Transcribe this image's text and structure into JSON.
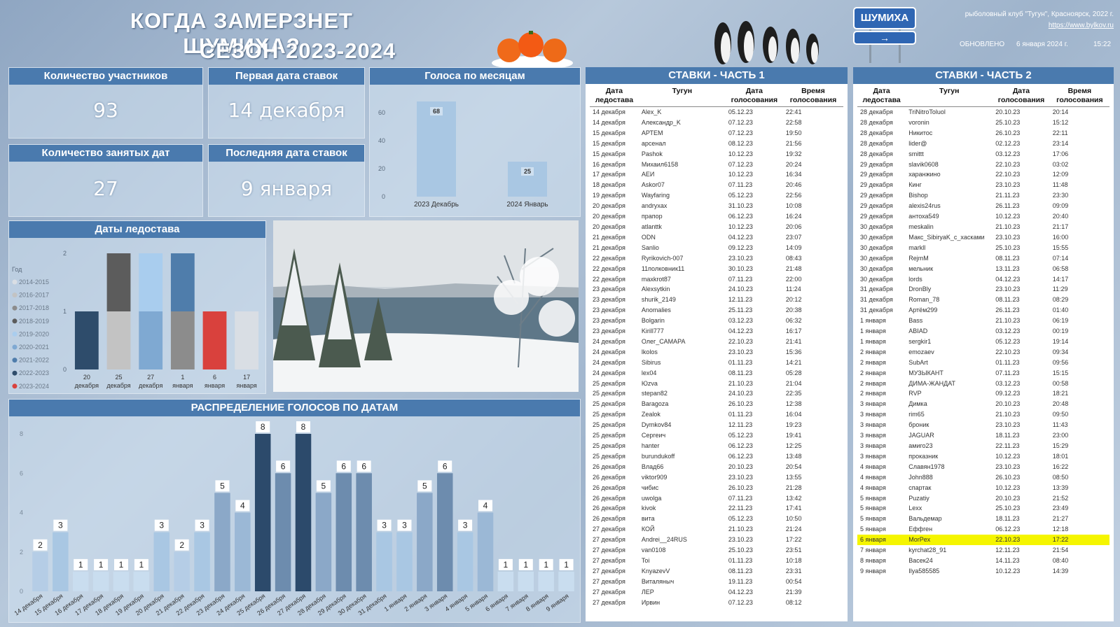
{
  "header": {
    "title_line1": "КОГДА ЗАМЕРЗНЕТ ШУМИХА?",
    "title_line2": "СЕЗОН 2023-2024",
    "sign_label": "ШУМИХА",
    "club": "рыболовный клуб \"Тугун\", Красноярск, 2022 г.",
    "link": "https://www.bylkov.ru",
    "updated_label": "ОБНОВЛЕНО",
    "updated_date": "6 января 2024 г.",
    "updated_time": "15:22"
  },
  "kpis": {
    "participants_label": "Количество участников",
    "participants_value": "93",
    "first_date_label": "Первая дата ставок",
    "first_date_value": "14 декабря",
    "dates_taken_label": "Количество занятых дат",
    "dates_taken_value": "27",
    "last_date_label": "Последняя дата ставок",
    "last_date_value": "9 января"
  },
  "colors": {
    "header_bg": "#4a7aae",
    "bar_light": "#a9c7e3",
    "bar_dark": "#2c4a6b",
    "highlight": "#f5f500",
    "red": "#d9413d"
  },
  "chart_data": [
    {
      "type": "bar",
      "title": "Голоса по месяцам",
      "categories": [
        "2023 Декабрь",
        "2024 Январь"
      ],
      "values": [
        68,
        25
      ],
      "ylim": [
        0,
        70
      ],
      "yticks": [
        0,
        20,
        40,
        60
      ],
      "color": "#a9c7e3"
    },
    {
      "type": "bar",
      "title": "Даты ледостава",
      "legend_title": "Год",
      "legend": [
        {
          "name": "2014-2015",
          "color": "#d9dee4"
        },
        {
          "name": "2016-2017",
          "color": "#c3c3c3"
        },
        {
          "name": "2017-2018",
          "color": "#8c8c8c"
        },
        {
          "name": "2018-2019",
          "color": "#5c5c5c"
        },
        {
          "name": "2019-2020",
          "color": "#a9cdee"
        },
        {
          "name": "2020-2021",
          "color": "#7fa9d2"
        },
        {
          "name": "2021-2022",
          "color": "#4f7dab"
        },
        {
          "name": "2022-2023",
          "color": "#2e4c6b"
        },
        {
          "name": "2023-2024",
          "color": "#d9413d"
        }
      ],
      "categories": [
        "20 декабря",
        "25 декабря",
        "27 декабря",
        "1 января",
        "6 января",
        "17 января"
      ],
      "stacks": [
        [
          {
            "series": "2022-2023",
            "value": 1
          }
        ],
        [
          {
            "series": "2016-2017",
            "value": 1
          },
          {
            "series": "2018-2019",
            "value": 1
          }
        ],
        [
          {
            "series": "2020-2021",
            "value": 1
          },
          {
            "series": "2019-2020",
            "value": 1
          }
        ],
        [
          {
            "series": "2017-2018",
            "value": 1
          },
          {
            "series": "2021-2022",
            "value": 1
          }
        ],
        [
          {
            "series": "2023-2024",
            "value": 1
          }
        ],
        [
          {
            "series": "2014-2015",
            "value": 1
          }
        ]
      ],
      "ylim": [
        0,
        2
      ],
      "yticks": [
        0,
        1,
        2
      ]
    },
    {
      "type": "bar",
      "title": "РАСПРЕДЕЛЕНИЕ ГОЛОСОВ ПО ДАТАМ",
      "categories": [
        "14 декабря",
        "15 декабря",
        "16 декабря",
        "17 декабря",
        "18 декабря",
        "19 декабря",
        "20 декабря",
        "21 декабря",
        "22 декабря",
        "23 декабря",
        "24 декабря",
        "25 декабря",
        "26 декабря",
        "27 декабря",
        "28 декабря",
        "29 декабря",
        "30 декабря",
        "31 декабря",
        "1 января",
        "2 января",
        "3 января",
        "4 января",
        "5 января",
        "6 января",
        "7 января",
        "8 января",
        "9 января"
      ],
      "values": [
        2,
        3,
        1,
        1,
        1,
        1,
        3,
        2,
        3,
        5,
        4,
        8,
        6,
        8,
        5,
        6,
        6,
        3,
        3,
        5,
        6,
        3,
        4,
        1,
        1,
        1,
        1
      ],
      "ylim": [
        0,
        8
      ],
      "yticks": [
        0,
        2,
        4,
        6,
        8
      ]
    }
  ],
  "table1": {
    "title": "СТАВКИ - ЧАСТЬ 1",
    "cols": [
      "Дата ледостава",
      "Тугун",
      "Дата голосования",
      "Время голосования"
    ],
    "rows": [
      [
        "14 декабря",
        "Alex_K",
        "05.12.23",
        "22:41"
      ],
      [
        "14 декабря",
        "Александр_K",
        "07.12.23",
        "22:58"
      ],
      [
        "15 декабря",
        "АРТЕМ",
        "07.12.23",
        "19:50"
      ],
      [
        "15 декабря",
        "арсенал",
        "08.12.23",
        "21:56"
      ],
      [
        "15 декабря",
        "Pashok",
        "10.12.23",
        "19:32"
      ],
      [
        "16 декабря",
        "Михаил6158",
        "07.12.23",
        "20:24"
      ],
      [
        "17 декабря",
        "АЕИ",
        "10.12.23",
        "16:34"
      ],
      [
        "18 декабря",
        "Askor07",
        "07.11.23",
        "20:46"
      ],
      [
        "19 декабря",
        "Wayfaring",
        "05.12.23",
        "22:56"
      ],
      [
        "20 декабря",
        "andryxax",
        "31.10.23",
        "10:08"
      ],
      [
        "20 декабря",
        "прапор",
        "06.12.23",
        "16:24"
      ],
      [
        "20 декабря",
        "atlanttk",
        "10.12.23",
        "20:06"
      ],
      [
        "21 декабря",
        "ODN",
        "04.12.23",
        "23:07"
      ],
      [
        "21 декабря",
        "Sanlio",
        "09.12.23",
        "14:09"
      ],
      [
        "22 декабря",
        "Ryrikovich-007",
        "23.10.23",
        "08:43"
      ],
      [
        "22 декабря",
        "11полковник11",
        "30.10.23",
        "21:48"
      ],
      [
        "22 декабря",
        "maxkrot87",
        "07.11.23",
        "22:00"
      ],
      [
        "23 декабря",
        "Alexsytkin",
        "24.10.23",
        "11:24"
      ],
      [
        "23 декабря",
        "shurik_2149",
        "12.11.23",
        "20:12"
      ],
      [
        "23 декабря",
        "Anomalies",
        "25.11.23",
        "20:38"
      ],
      [
        "23 декабря",
        "Bolgarin",
        "03.12.23",
        "06:32"
      ],
      [
        "23 декабря",
        "Kirill777",
        "04.12.23",
        "16:17"
      ],
      [
        "24 декабря",
        "Олег_САМАРА",
        "22.10.23",
        "21:41"
      ],
      [
        "24 декабря",
        "lkolos",
        "23.10.23",
        "15:36"
      ],
      [
        "24 декабря",
        "Sibirus",
        "01.11.23",
        "14:21"
      ],
      [
        "24 декабря",
        "lex04",
        "08.11.23",
        "05:28"
      ],
      [
        "25 декабря",
        "Юzva",
        "21.10.23",
        "21:04"
      ],
      [
        "25 декабря",
        "stepan82",
        "24.10.23",
        "22:35"
      ],
      [
        "25 декабря",
        "Baragoza",
        "26.10.23",
        "12:38"
      ],
      [
        "25 декабря",
        "Zealok",
        "01.11.23",
        "16:04"
      ],
      [
        "25 декабря",
        "Dymkov84",
        "12.11.23",
        "19:23"
      ],
      [
        "25 декабря",
        "Сергеич",
        "05.12.23",
        "19:41"
      ],
      [
        "25 декабря",
        "hanter",
        "06.12.23",
        "12:25"
      ],
      [
        "25 декабря",
        "burundukoff",
        "06.12.23",
        "13:48"
      ],
      [
        "26 декабря",
        "Влад66",
        "20.10.23",
        "20:54"
      ],
      [
        "26 декабря",
        "viktor909",
        "23.10.23",
        "13:55"
      ],
      [
        "26 декабря",
        "чибис",
        "26.10.23",
        "21:28"
      ],
      [
        "26 декабря",
        "uwolga",
        "07.11.23",
        "13:42"
      ],
      [
        "26 декабря",
        "kivok",
        "22.11.23",
        "17:41"
      ],
      [
        "26 декабря",
        "вита",
        "05.12.23",
        "10:50"
      ],
      [
        "27 декабря",
        "КОЙ",
        "21.10.23",
        "21:24"
      ],
      [
        "27 декабря",
        "Andrei__24RUS",
        "23.10.23",
        "17:22"
      ],
      [
        "27 декабря",
        "van0108",
        "25.10.23",
        "23:51"
      ],
      [
        "27 декабря",
        "Toi",
        "01.11.23",
        "10:18"
      ],
      [
        "27 декабря",
        "KnyazevV",
        "08.11.23",
        "23:31"
      ],
      [
        "27 декабря",
        "Виталяныч",
        "19.11.23",
        "00:54"
      ],
      [
        "27 декабря",
        "ЛЕР",
        "04.12.23",
        "21:39"
      ],
      [
        "27 декабря",
        "Ирвин",
        "07.12.23",
        "08:12"
      ]
    ]
  },
  "table2": {
    "title": "СТАВКИ - ЧАСТЬ 2",
    "cols": [
      "Дата ледостава",
      "Тугун",
      "Дата голосования",
      "Время голосования"
    ],
    "rows": [
      [
        "28 декабря",
        "TriNitroToluol",
        "20.10.23",
        "20:14"
      ],
      [
        "28 декабря",
        "voronin",
        "25.10.23",
        "15:12"
      ],
      [
        "28 декабря",
        "Никитос",
        "26.10.23",
        "22:11"
      ],
      [
        "28 декабря",
        "lider@",
        "02.12.23",
        "23:14"
      ],
      [
        "28 декабря",
        "smittt",
        "03.12.23",
        "17:06"
      ],
      [
        "29 декабря",
        "slavik0608",
        "22.10.23",
        "03:02"
      ],
      [
        "29 декабря",
        "харанжино",
        "22.10.23",
        "12:09"
      ],
      [
        "29 декабря",
        "Кинг",
        "23.10.23",
        "11:48"
      ],
      [
        "29 декабря",
        "Bishop",
        "21.11.23",
        "23:30"
      ],
      [
        "29 декабря",
        "alexis24rus",
        "26.11.23",
        "09:09"
      ],
      [
        "29 декабря",
        "антоха549",
        "10.12.23",
        "20:40"
      ],
      [
        "30 декабря",
        "meskalin",
        "21.10.23",
        "21:17"
      ],
      [
        "30 декабря",
        "Макс_SibiryaK_c_хасками",
        "23.10.23",
        "16:00"
      ],
      [
        "30 декабря",
        "markll",
        "25.10.23",
        "15:55"
      ],
      [
        "30 декабря",
        "RejmM",
        "08.11.23",
        "07:14"
      ],
      [
        "30 декабря",
        "мельник",
        "13.11.23",
        "06:58"
      ],
      [
        "30 декабря",
        "lords",
        "04.12.23",
        "14:17"
      ],
      [
        "31 декабря",
        "DronBly",
        "23.10.23",
        "11:29"
      ],
      [
        "31 декабря",
        "Roman_78",
        "08.11.23",
        "08:29"
      ],
      [
        "31 декабря",
        "Артём299",
        "26.11.23",
        "01:40"
      ],
      [
        "1 января",
        "Bass",
        "21.10.23",
        "06:19"
      ],
      [
        "1 января",
        "ABIAD",
        "03.12.23",
        "00:19"
      ],
      [
        "1 января",
        "sergkir1",
        "05.12.23",
        "19:14"
      ],
      [
        "2 января",
        "emozaev",
        "22.10.23",
        "09:34"
      ],
      [
        "2 января",
        "SubArt",
        "01.11.23",
        "09:56"
      ],
      [
        "2 января",
        "МУЗЫКАНТ",
        "07.11.23",
        "15:15"
      ],
      [
        "2 января",
        "ДИМА-ЖАНДАТ",
        "03.12.23",
        "00:58"
      ],
      [
        "2 января",
        "RVP",
        "09.12.23",
        "18:21"
      ],
      [
        "3 января",
        "Димка",
        "20.10.23",
        "20:48"
      ],
      [
        "3 января",
        "rim65",
        "21.10.23",
        "09:50"
      ],
      [
        "3 января",
        "броник",
        "23.10.23",
        "11:43"
      ],
      [
        "3 января",
        "JAGUAR",
        "18.11.23",
        "23:00"
      ],
      [
        "3 января",
        "амиго23",
        "22.11.23",
        "15:29"
      ],
      [
        "3 января",
        "проказник",
        "10.12.23",
        "18:01"
      ],
      [
        "4 января",
        "Славян1978",
        "23.10.23",
        "16:22"
      ],
      [
        "4 января",
        "John888",
        "26.10.23",
        "08:50"
      ],
      [
        "4 января",
        "спартак",
        "10.12.23",
        "13:39"
      ],
      [
        "5 января",
        "Puzatiy",
        "20.10.23",
        "21:52"
      ],
      [
        "5 января",
        "Lexx",
        "25.10.23",
        "23:49"
      ],
      [
        "5 января",
        "Вальдемар",
        "18.11.23",
        "21:27"
      ],
      [
        "5 января",
        "Еффген",
        "06.12.23",
        "12:18"
      ],
      [
        "6 января",
        "MorPex",
        "22.10.23",
        "17:22"
      ],
      [
        "7 января",
        "kyrchat28_91",
        "12.11.23",
        "21:54"
      ],
      [
        "8 января",
        "Васек24",
        "14.11.23",
        "08:40"
      ],
      [
        "9 января",
        "Ilya585585",
        "10.12.23",
        "14:39"
      ]
    ],
    "highlight_row": 41
  }
}
